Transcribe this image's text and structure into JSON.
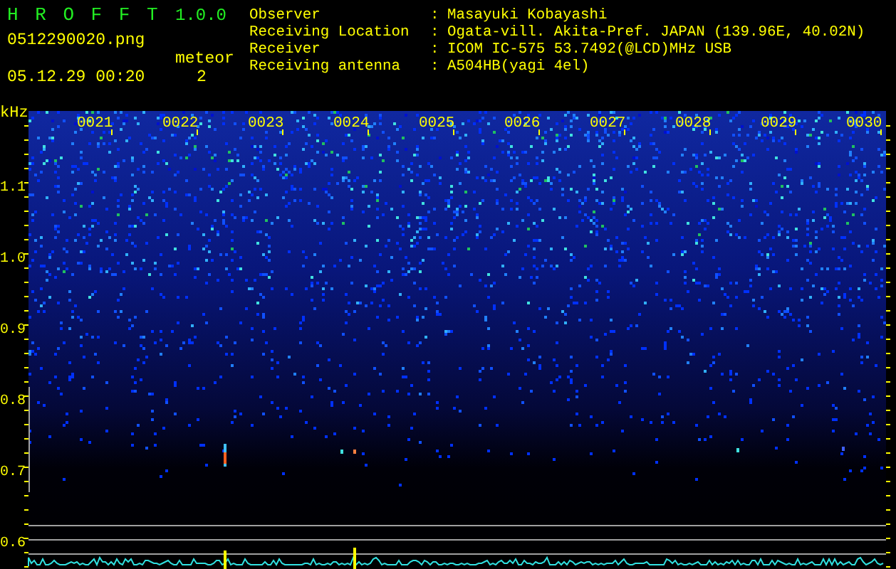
{
  "app": {
    "title": "H R O F F T",
    "version": "1.0.0"
  },
  "file": {
    "name": "0512290020.png",
    "timestamp": "05.12.29 00:20"
  },
  "meteor": {
    "label": "meteor",
    "count": "2"
  },
  "station_info": [
    {
      "label": "Observer",
      "separator": ":",
      "value": "Masayuki Kobayashi"
    },
    {
      "label": "Receiving Location",
      "separator": ":",
      "value": "Ogata-vill. Akita-Pref. JAPAN (139.96E, 40.02N)"
    },
    {
      "label": "Receiver",
      "separator": ":",
      "value": "ICOM IC-575 53.7492(@LCD)MHz USB"
    },
    {
      "label": "Receiving antenna",
      "separator": ":",
      "value": "A504HB(yagi 4el)"
    }
  ],
  "spectrogram": {
    "y_unit": "kHz",
    "y_labels": [
      "1.1",
      "1.0",
      "0.9",
      "0.8",
      "0.7",
      "0.6"
    ],
    "time_labels": [
      "0021",
      "0022",
      "0023",
      "0024",
      "0025",
      "0026",
      "0027",
      "0028",
      "0029",
      "0030"
    ]
  }
}
